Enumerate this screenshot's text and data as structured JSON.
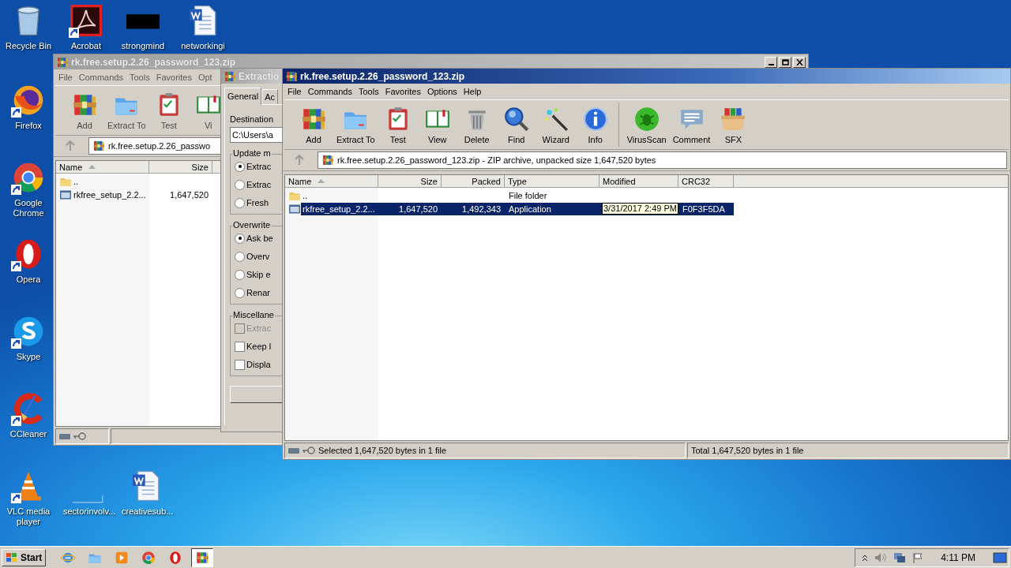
{
  "desktop_icons": [
    {
      "label": "Recycle Bin",
      "kind": "recycle",
      "shortcut": false
    },
    {
      "label": "Acrobat",
      "kind": "acrobat",
      "shortcut": true
    },
    {
      "label": "strongmind",
      "kind": "dark",
      "shortcut": false
    },
    {
      "label": "networkingi",
      "kind": "word",
      "shortcut": false
    },
    {
      "label": "Firefox",
      "kind": "firefox",
      "shortcut": true
    },
    {
      "label": "Google Chrome",
      "kind": "chrome",
      "shortcut": true
    },
    {
      "label": "Opera",
      "kind": "opera",
      "shortcut": true
    },
    {
      "label": "Skype",
      "kind": "skype",
      "shortcut": true
    },
    {
      "label": "CCleaner",
      "kind": "ccleaner",
      "shortcut": true
    },
    {
      "label": "VLC media player",
      "kind": "vlc",
      "shortcut": true
    },
    {
      "label": "sectorinvolv...",
      "kind": "blank",
      "shortcut": false
    },
    {
      "label": "creativesub...",
      "kind": "word",
      "shortcut": false
    }
  ],
  "back_window": {
    "title": "rk.free.setup.2.26_password_123.zip",
    "menu": [
      "File",
      "Commands",
      "Tools",
      "Favorites",
      "Opt"
    ],
    "toolbar": [
      {
        "label": "Add",
        "kind": "add"
      },
      {
        "label": "Extract To",
        "kind": "extract"
      },
      {
        "label": "Test",
        "kind": "test"
      },
      {
        "label": "Vi",
        "kind": "view"
      }
    ],
    "address": "rk.free.setup.2.26_passwo",
    "columns": [
      {
        "label": "Name",
        "sorted": true
      },
      {
        "label": "Size",
        "sorted": false
      }
    ],
    "rows": [
      {
        "kind": "folder",
        "name": ".."
      },
      {
        "kind": "file",
        "name": "rkfree_setup_2.2...",
        "size": "1,647,520"
      }
    ]
  },
  "extraction_dialog": {
    "title": "Extractio",
    "tabs": [
      {
        "label": "General",
        "selected": true
      },
      {
        "label": "Ac",
        "selected": false
      }
    ],
    "destination_label": "Destination",
    "destination": "C:\\Users\\a",
    "groups": [
      {
        "title": "Update m",
        "kind": "radio",
        "items": [
          {
            "label": "Extrac",
            "selected": true
          },
          {
            "label": "Extrac",
            "selected": false
          },
          {
            "label": "Fresh",
            "selected": false
          }
        ]
      },
      {
        "title": "Overwrite",
        "kind": "radio",
        "items": [
          {
            "label": "Ask be",
            "selected": true
          },
          {
            "label": "Overv",
            "selected": false
          },
          {
            "label": "Skip e",
            "selected": false
          },
          {
            "label": "Renar",
            "selected": false
          }
        ]
      },
      {
        "title": "Miscellane",
        "kind": "checkbox",
        "items": [
          {
            "label": "Extrac",
            "checked": false,
            "disabled": true
          },
          {
            "label": "Keep l",
            "checked": false,
            "disabled": false
          },
          {
            "label": "Displa",
            "checked": false,
            "disabled": false
          }
        ]
      }
    ]
  },
  "front_window": {
    "title": "rk.free.setup.2.26_password_123.zip",
    "menu": [
      "File",
      "Commands",
      "Tools",
      "Favorites",
      "Options",
      "Help"
    ],
    "toolbar_groups": [
      {
        "buttons": [
          {
            "label": "Add",
            "kind": "add"
          },
          {
            "label": "Extract To",
            "kind": "extract"
          },
          {
            "label": "Test",
            "kind": "test"
          },
          {
            "label": "View",
            "kind": "view"
          },
          {
            "label": "Delete",
            "kind": "delete"
          },
          {
            "label": "Find",
            "kind": "find"
          },
          {
            "label": "Wizard",
            "kind": "wizard"
          },
          {
            "label": "Info",
            "kind": "info"
          }
        ]
      },
      {
        "buttons": [
          {
            "label": "VirusScan",
            "kind": "virusscan"
          },
          {
            "label": "Comment",
            "kind": "comment"
          },
          {
            "label": "SFX",
            "kind": "sfx"
          }
        ]
      }
    ],
    "address": "rk.free.setup.2.26_password_123.zip - ZIP archive, unpacked size 1,647,520 bytes",
    "columns": [
      {
        "label": "Name",
        "sorted": true
      },
      {
        "label": "Size",
        "sorted": false
      },
      {
        "label": "Packed",
        "sorted": false
      },
      {
        "label": "Type",
        "sorted": false
      },
      {
        "label": "Modified",
        "sorted": false
      },
      {
        "label": "CRC32",
        "sorted": false
      }
    ],
    "rows": [
      {
        "kind": "folder",
        "name": "..",
        "type": "File folder",
        "selected": false
      },
      {
        "kind": "file",
        "name": "rkfree_setup_2.2...",
        "size": "1,647,520",
        "packed": "1,492,343",
        "type": "Application",
        "modified": "3/31/2017 2:49 PM",
        "crc32": "F0F3F5DA",
        "selected": true,
        "tooltip": true
      }
    ],
    "status": [
      "Selected 1,647,520 bytes in 1 file",
      "Total 1,647,520 bytes in 1 file"
    ]
  },
  "taskbar": {
    "start": "Start",
    "apps": [
      {
        "kind": "ie",
        "active": false
      },
      {
        "kind": "explorer",
        "active": false
      },
      {
        "kind": "media",
        "active": false
      },
      {
        "kind": "chrome",
        "active": false
      },
      {
        "kind": "opera",
        "active": false
      },
      {
        "kind": "add",
        "active": true
      }
    ],
    "clock": "4:11 PM"
  }
}
